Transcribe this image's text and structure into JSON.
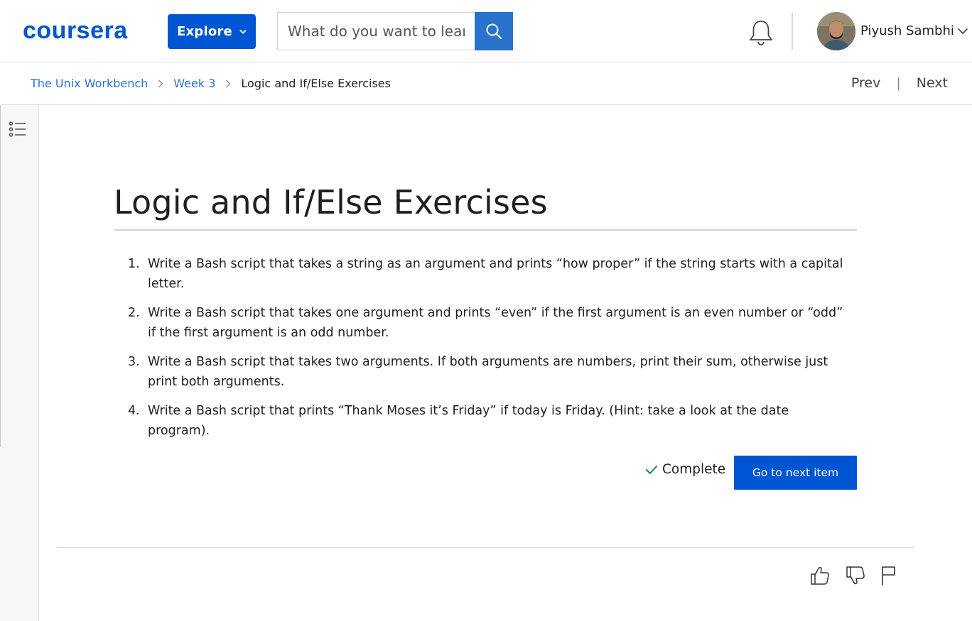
{
  "header": {
    "logo_text": "coursera",
    "explore_label": "Explore",
    "search_placeholder": "What do you want to learn?",
    "user_name": "Piyush Sambhi"
  },
  "breadcrumb": {
    "items": [
      "The Unix Workbench",
      "Week 3"
    ],
    "current": "Logic and If/Else Exercises"
  },
  "navigation": {
    "prev_label": "Prev",
    "separator": "|",
    "next_label": "Next"
  },
  "main": {
    "title": "Logic and If/Else Exercises",
    "exercises": [
      {
        "num": "1.",
        "text": "Write a Bash script that takes a string as an argument and prints “how proper” if the string starts with a capital letter."
      },
      {
        "num": "2.",
        "text": "Write a Bash script that takes one argument and prints “even” if the first argument is an even number or “odd” if the first argument is an odd number."
      },
      {
        "num": "3.",
        "text": "Write a Bash script that takes two arguments. If both arguments are numbers, print their sum, otherwise just print both arguments."
      },
      {
        "num": "4.",
        "text": "Write a Bash script that prints “Thank Moses it’s Friday” if today is Friday. (Hint: take a look at the date program)."
      }
    ],
    "complete_label": "Complete",
    "next_item_label": "Go to next item"
  },
  "colors": {
    "brand_blue": "#0056d2",
    "link_blue": "#2a73cc",
    "complete_green": "#1f8354"
  },
  "icons": [
    "search-icon",
    "bell-icon",
    "chevron-down-icon",
    "chevron-right-icon",
    "list-icon",
    "check-icon",
    "thumbs-up-icon",
    "thumbs-down-icon",
    "flag-icon"
  ]
}
